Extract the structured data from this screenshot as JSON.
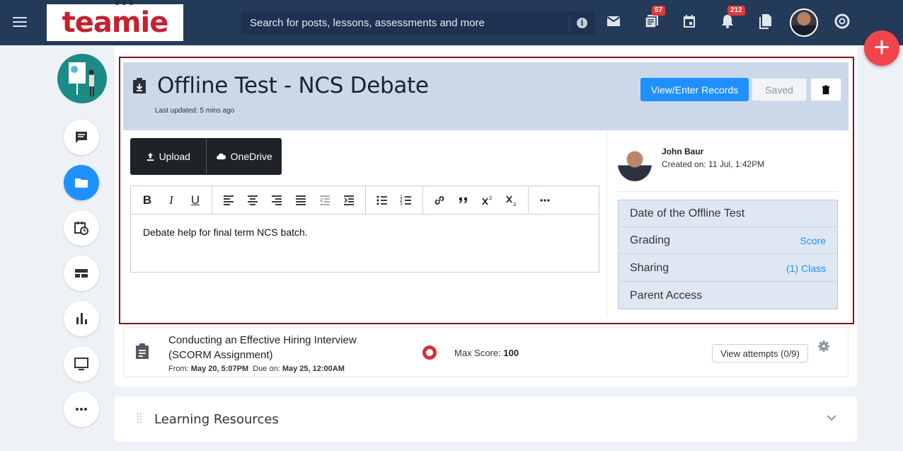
{
  "topbar": {
    "logo_text": "teamie",
    "search_placeholder": "Search for posts, lessons, assessments and more",
    "badges": {
      "posts": "57",
      "notifications": "212"
    }
  },
  "assessment": {
    "title": "Offline Test - NCS Debate",
    "last_updated": "Last updated: 5 mins ago",
    "view_records_label": "View/Enter Records",
    "saved_label": "Saved",
    "upload_label": "Upload",
    "onedrive_label": "OneDrive",
    "body_text": "Debate help for final term NCS batch.",
    "author_name": "John Baur",
    "created_on": "Created on: 11 Jul, 1:42PM",
    "settings": [
      {
        "label": "Date of the Offline Test",
        "value": ""
      },
      {
        "label": "Grading",
        "value": "Score"
      },
      {
        "label": "Sharing",
        "value": "(1) Class"
      },
      {
        "label": "Parent Access",
        "value": ""
      }
    ]
  },
  "scorm_item": {
    "title": "Conducting an Effective Hiring Interview (SCORM Assignment)",
    "from_label": "From:",
    "from_value": "May 20, 5:07PM",
    "due_label": "Due on:",
    "due_value": "May 25, 12:00AM",
    "max_score_label": "Max Score:",
    "max_score_value": "100",
    "attempts_label": "View attempts (0/9)"
  },
  "learning_resources": {
    "title": "Learning Resources"
  },
  "colors": {
    "accent": "#1f90ff",
    "topbar": "#243a59",
    "fab": "#f2444d",
    "selection_border": "#7b1820"
  }
}
